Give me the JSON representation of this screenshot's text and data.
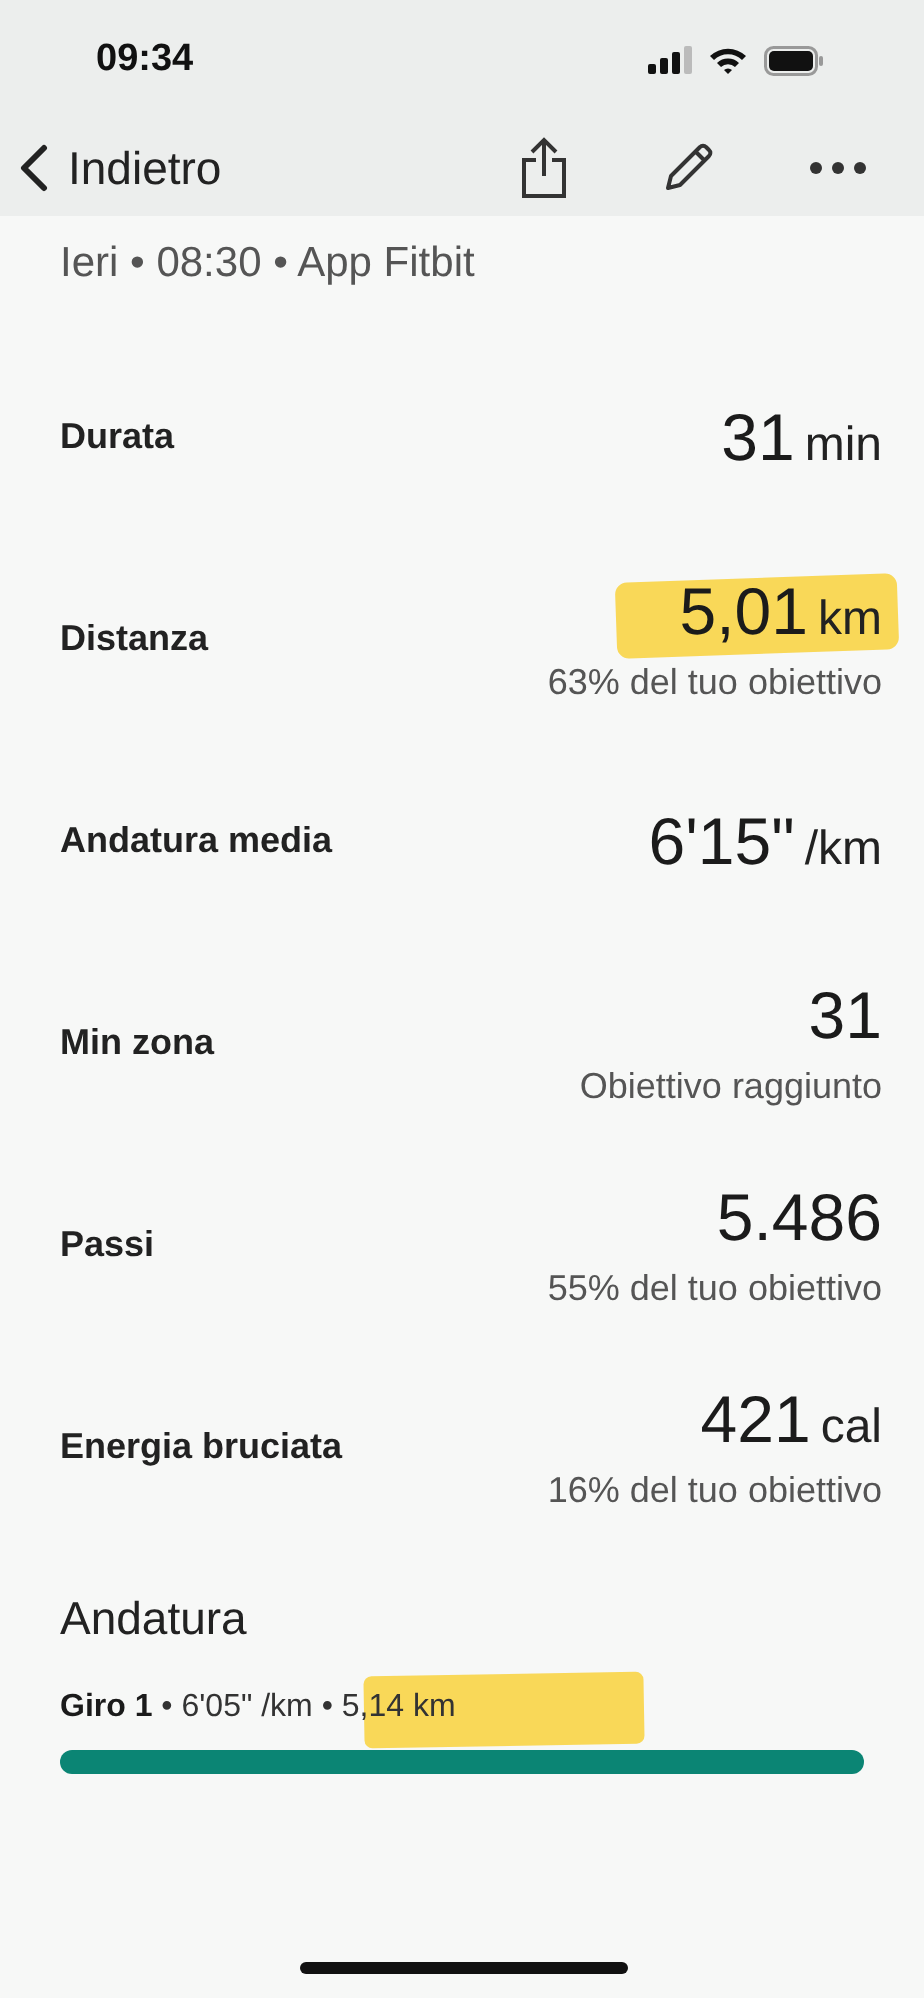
{
  "status_bar": {
    "time": "09:34"
  },
  "nav_bar": {
    "back_label": "Indietro"
  },
  "subtitle": "Ieri • 08:30 • App Fitbit",
  "metrics": [
    {
      "label": "Durata",
      "value": "31",
      "unit": "min",
      "highlighted": false
    },
    {
      "label": "Distanza",
      "value": "5,01",
      "unit": "km",
      "note": "63% del tuo obiettivo",
      "highlighted": true
    },
    {
      "label": "Andatura media",
      "value": "6'15\"",
      "unit": "/km",
      "highlighted": false
    },
    {
      "label": "Min zona",
      "value": "31",
      "note": "Obiettivo raggiunto",
      "highlighted": false
    },
    {
      "label": "Passi",
      "value": "5.486",
      "note": "55% del tuo obiettivo",
      "highlighted": false
    },
    {
      "label": "Energia bruciata",
      "value": "421",
      "unit": "cal",
      "note": "16% del tuo obiettivo",
      "highlighted": false
    }
  ],
  "pace": {
    "title": "Andatura",
    "laps": [
      {
        "text": "**Giro 1** • 6'05\" /km • 5,14 km",
        "highlighted": true
      }
    ]
  }
}
